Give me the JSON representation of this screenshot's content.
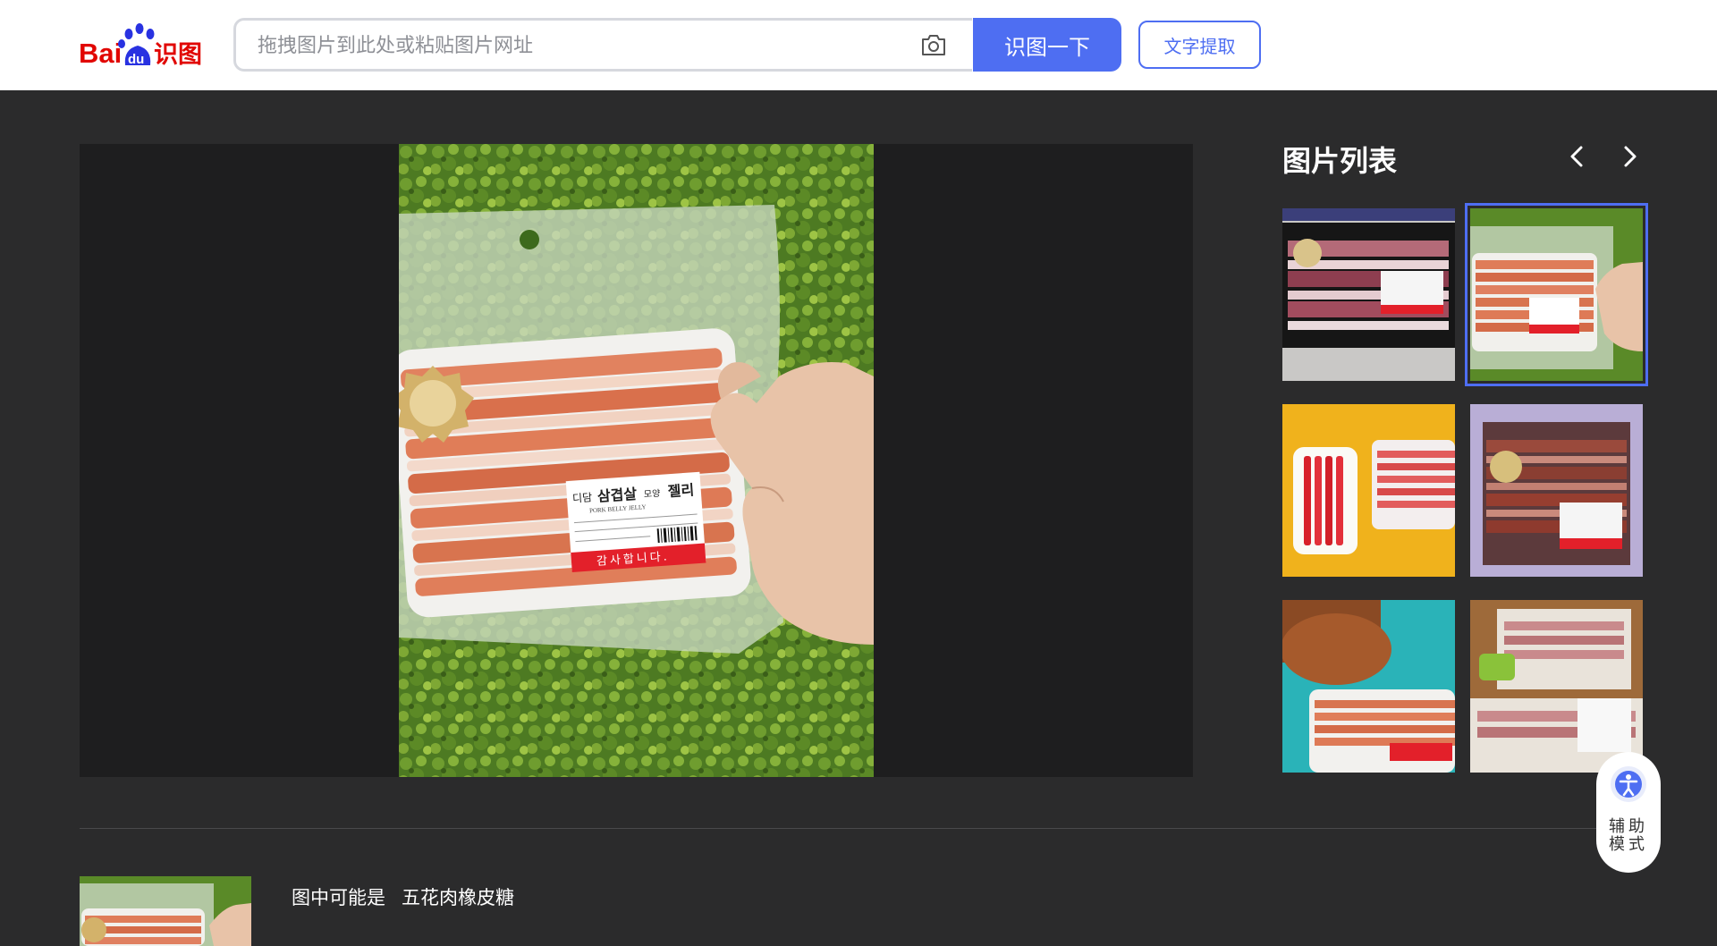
{
  "header": {
    "logo_text_left": "Bai",
    "logo_text_mid": "du",
    "logo_text_right": "识图",
    "search_placeholder": "拖拽图片到此处或粘贴图片网址",
    "search_button": "识图一下",
    "text_extract_button": "文字提取",
    "camera_icon": "camera-icon"
  },
  "sidebar": {
    "title": "图片列表",
    "prev_icon": "chevron-left-icon",
    "next_icon": "chevron-right-icon",
    "thumbnails": [
      {
        "label": "thumbnail-1",
        "selected": false
      },
      {
        "label": "thumbnail-2",
        "selected": true
      },
      {
        "label": "thumbnail-3",
        "selected": false
      },
      {
        "label": "thumbnail-4",
        "selected": false
      },
      {
        "label": "thumbnail-5",
        "selected": false
      },
      {
        "label": "thumbnail-6",
        "selected": false
      }
    ]
  },
  "photo": {
    "label_title_prefix": "디담",
    "label_title_main": "삼겹살",
    "label_title_small": "모양",
    "label_title_end": "젤리",
    "label_english": "PORK BELLY JELLY",
    "label_thanks": "감사합니다."
  },
  "result": {
    "prefix": "图中可能是",
    "name": "五花肉橡皮糖"
  },
  "assist": {
    "label": "辅助模式",
    "icon": "accessibility-icon"
  },
  "colors": {
    "brand_blue": "#4e6ef2",
    "baidu_red": "#e10602",
    "page_bg": "#2b2b2c"
  }
}
